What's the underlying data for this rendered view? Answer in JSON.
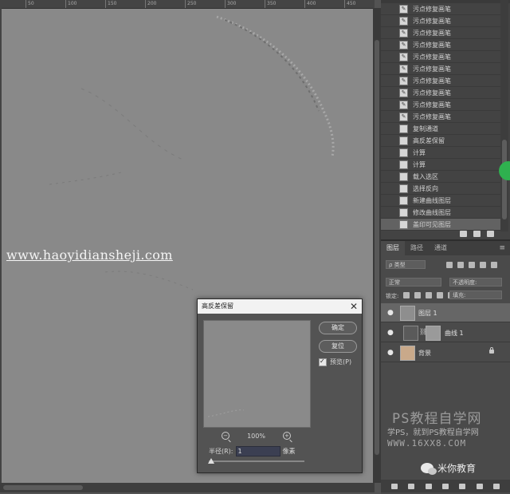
{
  "ruler": {
    "ticks": [
      "50",
      "100",
      "150",
      "200",
      "250",
      "300",
      "350",
      "400",
      "450"
    ]
  },
  "canvas": {
    "watermark_url": "www.haoyidiansheji.com",
    "bg_color": "#898989"
  },
  "dialog": {
    "title": "高反差保留",
    "close_icon": "close-icon",
    "ok_label": "确定",
    "reset_label": "复位",
    "preview_label": "预览(P)",
    "preview_checked": true,
    "zoom_level": "100%",
    "radius_label": "半径(R):",
    "radius_value": "1",
    "radius_unit": "像素"
  },
  "history": {
    "items": [
      {
        "label": "污点修复画笔",
        "icon": "brush-icon"
      },
      {
        "label": "污点修复画笔",
        "icon": "brush-icon"
      },
      {
        "label": "污点修复画笔",
        "icon": "brush-icon"
      },
      {
        "label": "污点修复画笔",
        "icon": "brush-icon"
      },
      {
        "label": "污点修复画笔",
        "icon": "brush-icon"
      },
      {
        "label": "污点修复画笔",
        "icon": "brush-icon"
      },
      {
        "label": "污点修复画笔",
        "icon": "brush-icon"
      },
      {
        "label": "污点修复画笔",
        "icon": "brush-icon"
      },
      {
        "label": "污点修复画笔",
        "icon": "brush-icon"
      },
      {
        "label": "污点修复画笔",
        "icon": "brush-icon"
      },
      {
        "label": "复制通道",
        "icon": "document-icon"
      },
      {
        "label": "高反差保留",
        "icon": "document-icon"
      },
      {
        "label": "计算",
        "icon": "document-icon"
      },
      {
        "label": "计算",
        "icon": "document-icon"
      },
      {
        "label": "载入选区",
        "icon": "document-icon"
      },
      {
        "label": "选择反向",
        "icon": "document-icon"
      },
      {
        "label": "新建曲线图层",
        "icon": "document-icon"
      },
      {
        "label": "修改曲线图层",
        "icon": "document-icon"
      },
      {
        "label": "盖印可见图层",
        "icon": "document-icon",
        "active": true
      }
    ]
  },
  "layers": {
    "tabs": [
      "图层",
      "路径",
      "通道"
    ],
    "filter_placeholder": "ρ 类型",
    "blend_mode": "正常",
    "opacity_label": "不透明度:",
    "fill_label": "填充:",
    "lock_label": "锁定:",
    "rows": [
      {
        "name": "图层 1",
        "active": true
      },
      {
        "name": "曲线 1",
        "active": false
      },
      {
        "name": "背景",
        "active": false,
        "locked": true
      }
    ]
  },
  "watermark": {
    "title": "PS教程自学网",
    "line2": "学PS，就到PS教程自学网",
    "line3": "WWW.16XX8.COM",
    "brand": "米你教育"
  }
}
